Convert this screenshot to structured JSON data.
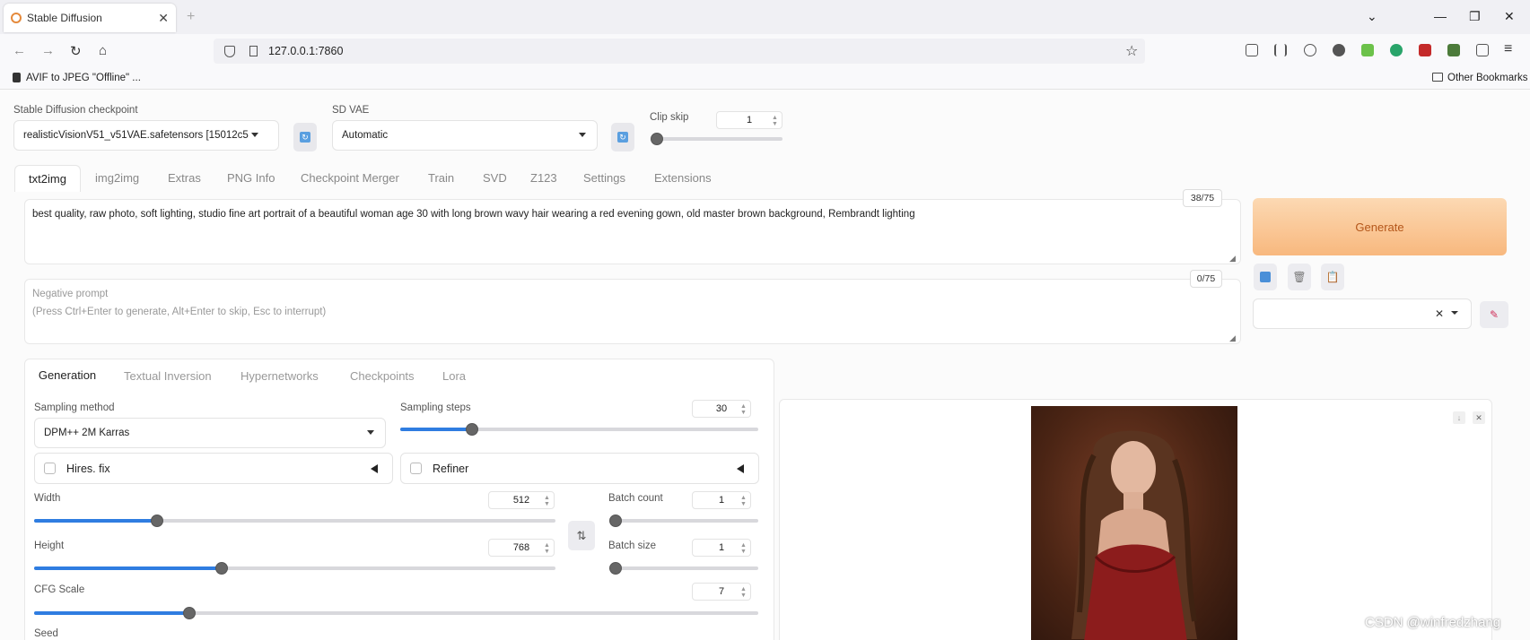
{
  "browser": {
    "tab_title": "Stable Diffusion",
    "url": "127.0.0.1:7860",
    "bookmark_left": "AVIF to JPEG \"Offline\" ...",
    "bookmark_right": "Other Bookmarks"
  },
  "settings": {
    "checkpoint_label": "Stable Diffusion checkpoint",
    "checkpoint_value": "realisticVisionV51_v51VAE.safetensors [15012c5",
    "vae_label": "SD VAE",
    "vae_value": "Automatic",
    "clip_skip_label": "Clip skip",
    "clip_skip_value": "1",
    "clip_skip_fraction": 0.0
  },
  "main_tabs": [
    "txt2img",
    "img2img",
    "Extras",
    "PNG Info",
    "Checkpoint Merger",
    "Train",
    "SVD",
    "Z123",
    "Settings",
    "Extensions"
  ],
  "prompt": {
    "text": "best quality, raw photo, soft lighting, studio fine art portrait of a beautiful woman age 30 with long brown wavy hair wearing a red evening gown, old master brown background, Rembrandt lighting",
    "counter": "38/75",
    "negative_placeholder_1": "Negative prompt",
    "negative_placeholder_2": "(Press Ctrl+Enter to generate, Alt+Enter to skip, Esc to interrupt)",
    "negative_counter": "0/75"
  },
  "generate_label": "Generate",
  "sub_tabs": [
    "Generation",
    "Textual Inversion",
    "Hypernetworks",
    "Checkpoints",
    "Lora"
  ],
  "generation": {
    "sampling_method_label": "Sampling method",
    "sampling_method_value": "DPM++ 2M Karras",
    "sampling_steps_label": "Sampling steps",
    "sampling_steps_value": "30",
    "sampling_steps_fraction": 0.2,
    "hires_label": "Hires. fix",
    "refiner_label": "Refiner",
    "width_label": "Width",
    "width_value": "512",
    "width_fraction": 0.235,
    "height_label": "Height",
    "height_value": "768",
    "height_fraction": 0.36,
    "batch_count_label": "Batch count",
    "batch_count_value": "1",
    "batch_size_label": "Batch size",
    "batch_size_value": "1",
    "cfg_label": "CFG Scale",
    "cfg_value": "7",
    "cfg_fraction": 0.214,
    "seed_label": "Seed"
  },
  "watermark": "CSDN @winfredzhang",
  "colors": {
    "accent": "#2f7de1",
    "generate_from": "#fcd9b3",
    "generate_to": "#f8b87e",
    "generate_text": "#b4561a"
  }
}
